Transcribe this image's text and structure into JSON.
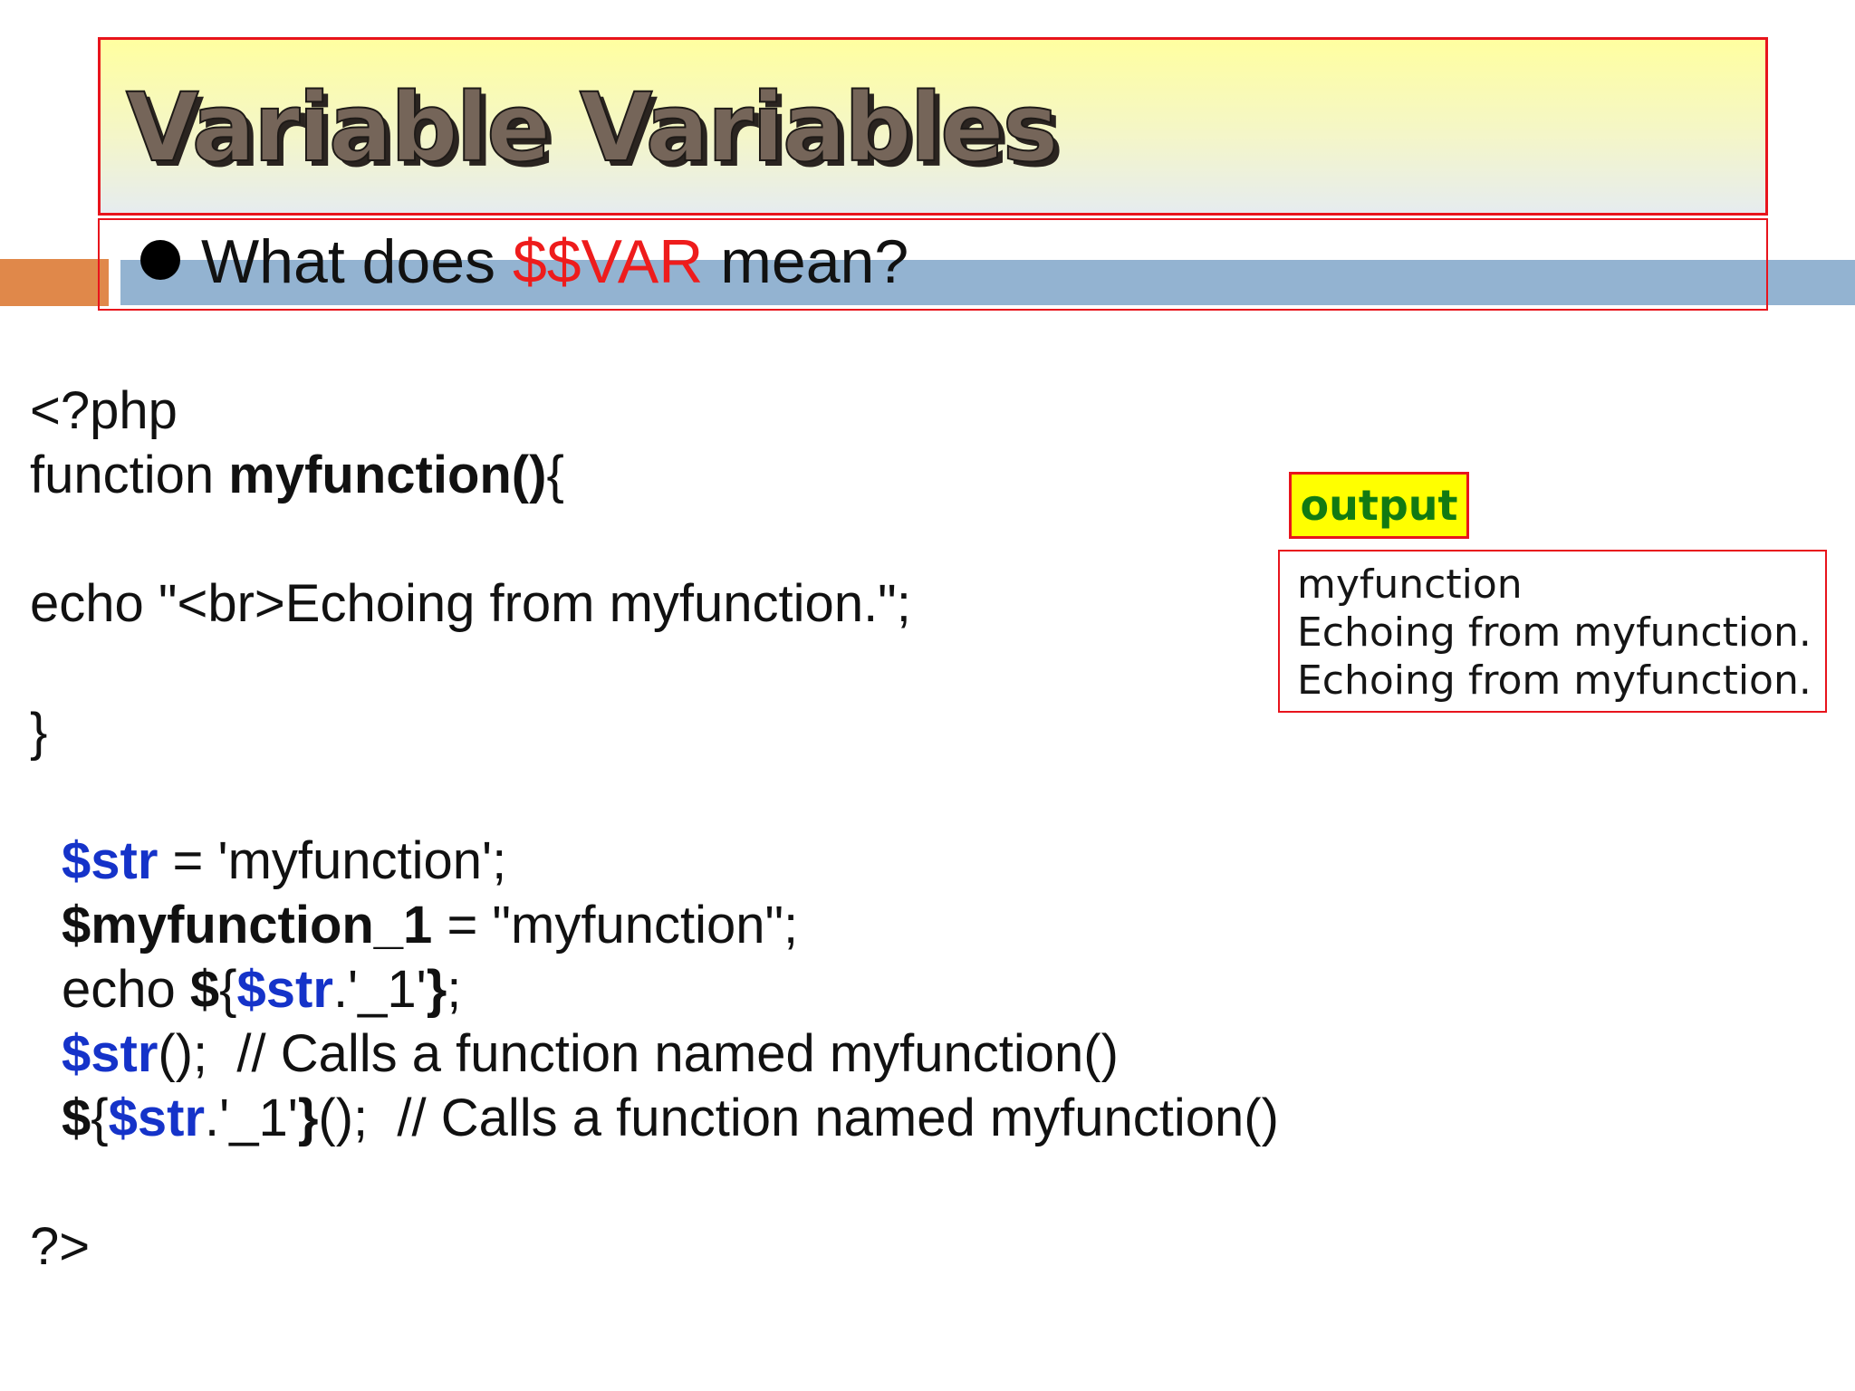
{
  "slide": {
    "title": "Variable Variables",
    "bullet": {
      "before": "What does ",
      "highlight": "$$VAR",
      "after": " mean?"
    }
  },
  "code": {
    "line1": "<?php",
    "line2_kw": "function ",
    "line2_name": "myfunction()",
    "line2_brace": "{",
    "line4": "echo \"<br>Echoing from myfunction.\";",
    "line6": "}",
    "line8_var": "$str",
    "line8_rest": " = 'myfunction';",
    "line9_var": "$myfunction_1",
    "line9_rest": " = \"myfunction\";",
    "line10_kw": "echo ",
    "line10_dollar": "$",
    "line10_open": "{",
    "line10_var": "$str",
    "line10_rest": ".'_1'",
    "line10_close": "}",
    "line10_end": ";",
    "line11_var": "$str",
    "line11_rest": "();  // Calls a function named myfunction()",
    "line12_dollar": "$",
    "line12_open": "{",
    "line12_var": "$str",
    "line12_rest": ".'_1'",
    "line12_close": "}",
    "line12_end": "();  // Calls a function named myfunction()",
    "line14": "?>"
  },
  "output": {
    "label": "output",
    "lines": [
      "myfunction",
      "Echoing from myfunction.",
      "Echoing from myfunction."
    ]
  },
  "colors": {
    "title_border": "#e8141c",
    "accent_orange": "#e0884a",
    "accent_blue": "#93b3d1",
    "variable_blue": "#1533c9",
    "highlight_red": "#ee1c1c",
    "output_label_bg": "#ffff00",
    "output_label_text": "#127a12"
  }
}
